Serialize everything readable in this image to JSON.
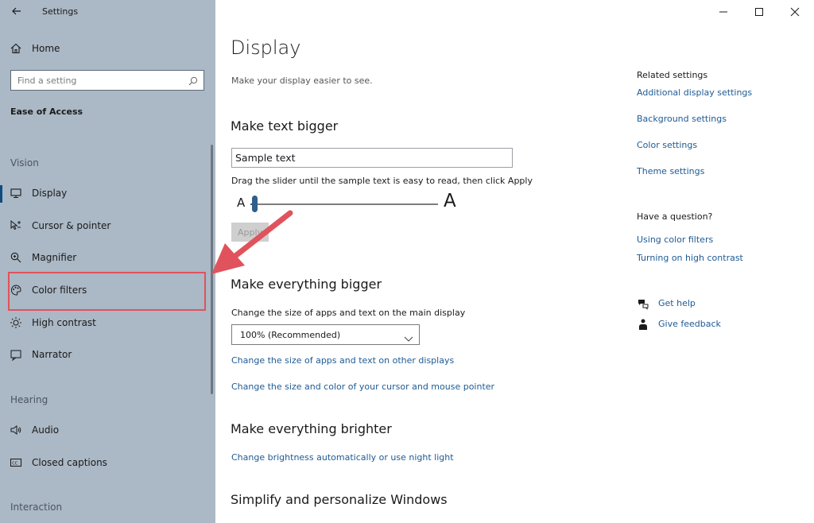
{
  "window": {
    "title": "Settings"
  },
  "sidebar": {
    "home_label": "Home",
    "search": {
      "placeholder": "Find a setting"
    },
    "section_title": "Ease of Access",
    "groups": {
      "vision": "Vision",
      "hearing": "Hearing",
      "interaction": "Interaction"
    },
    "items": [
      {
        "label": "Display",
        "icon": "monitor-icon",
        "selected": true
      },
      {
        "label": "Cursor & pointer",
        "icon": "cursor-icon"
      },
      {
        "label": "Magnifier",
        "icon": "magnifier-icon"
      },
      {
        "label": "Color filters",
        "icon": "palette-icon"
      },
      {
        "label": "High contrast",
        "icon": "sun-contrast-icon"
      },
      {
        "label": "Narrator",
        "icon": "narrator-icon"
      },
      {
        "label": "Audio",
        "icon": "speaker-icon"
      },
      {
        "label": "Closed captions",
        "icon": "captions-icon"
      }
    ]
  },
  "main": {
    "title": "Display",
    "subtitle": "Make your display easier to see.",
    "text_bigger": {
      "heading": "Make text bigger",
      "sample_value": "Sample text",
      "instructions": "Drag the slider until the sample text is easy to read, then click Apply",
      "slider_small_label": "A",
      "slider_large_label": "A",
      "slider_level": 0.02,
      "apply_label": "Apply"
    },
    "everything_bigger": {
      "heading": "Make everything bigger",
      "instructions": "Change the size of apps and text on the main display",
      "scale_value": "100% (Recommended)",
      "link_other_displays": "Change the size of apps and text on other displays",
      "link_cursor": "Change the size and color of your cursor and mouse pointer"
    },
    "brighter": {
      "heading": "Make everything brighter",
      "link": "Change brightness automatically or use night light"
    },
    "simplify": {
      "heading": "Simplify and personalize Windows"
    }
  },
  "related": {
    "heading": "Related settings",
    "links": [
      "Additional display settings",
      "Background settings",
      "Color settings",
      "Theme settings"
    ],
    "question_heading": "Have a question?",
    "question_links": [
      "Using color filters",
      "Turning on high contrast"
    ],
    "get_help": "Get help",
    "give_feedback": "Give feedback"
  },
  "colors": {
    "sidebar_bg": "#abb8c5",
    "accent": "#0f4c81",
    "link": "#1d5a94",
    "annotation": "#e0535c"
  }
}
